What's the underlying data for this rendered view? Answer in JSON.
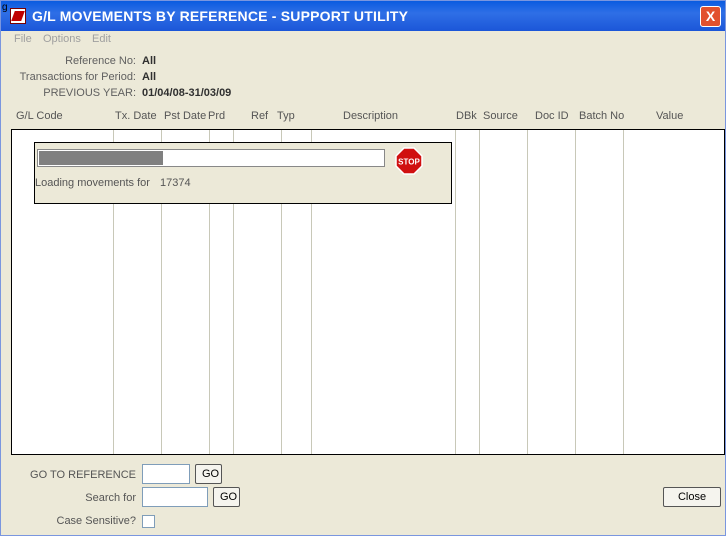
{
  "window": {
    "corner_mark": "g",
    "title": "G/L MOVEMENTS BY REFERENCE - SUPPORT UTILITY",
    "close_glyph": "X"
  },
  "menu": [
    "File",
    "Options",
    "Edit"
  ],
  "info": {
    "reference_label": "Reference No:",
    "reference_value": "All",
    "transactions_label": "Transactions for Period:",
    "transactions_value": "All",
    "prev_year_label": "PREVIOUS YEAR:",
    "prev_year_value": "01/04/08-31/03/09"
  },
  "columns": [
    "G/L Code",
    "Tx. Date",
    "Pst Date",
    "Prd",
    "Ref",
    "Typ",
    "Description",
    "DBk",
    "Source",
    "Doc ID",
    "Batch No",
    "Value"
  ],
  "loading": {
    "progress_fraction": 0.36,
    "stop_label": "STOP",
    "text": "Loading movements for",
    "count": "17374"
  },
  "goto": {
    "label": "GO TO REFERENCE",
    "value": "",
    "button": "GO"
  },
  "search": {
    "label": "Search for",
    "value": "",
    "button": "GO"
  },
  "case_sensitive": {
    "label": "Case Sensitive?",
    "checked": false
  },
  "close_button": "Close",
  "colors": {
    "title_bar": "#1b56d8",
    "window_bg": "#ECE9D8",
    "progress": "#808080",
    "stop": "#d01010"
  }
}
